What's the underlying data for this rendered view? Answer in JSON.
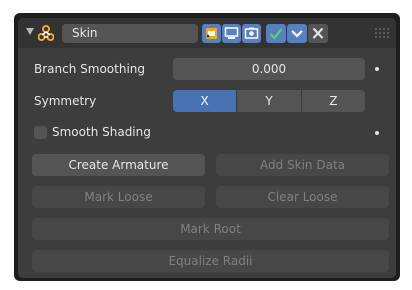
{
  "modifier": {
    "name": "Skin",
    "icons": {
      "collapse": "disclosure-triangle-icon",
      "modifier": "skin-modifier-icon",
      "edit_mode": "edit-mode-icon",
      "realtime": "viewport-display-icon",
      "render": "render-camera-icon",
      "apply": "checkmark-icon",
      "dropdown": "chevron-down-icon",
      "delete": "close-icon",
      "drag": "drag-grip-icon"
    },
    "colors": {
      "active_blue": "#5680c2",
      "modifier_icon_orange": "#f5a623",
      "apply_green": "#5fd35f"
    }
  },
  "props": {
    "branch_smoothing_label": "Branch Smoothing",
    "branch_smoothing_value": "0.000",
    "symmetry_label": "Symmetry",
    "symmetry_options": [
      "X",
      "Y",
      "Z"
    ],
    "symmetry_active": "X",
    "smooth_shading_label": "Smooth Shading",
    "smooth_shading_checked": false
  },
  "buttons": {
    "create_armature": "Create Armature",
    "add_skin_data": "Add Skin Data",
    "mark_loose": "Mark Loose",
    "clear_loose": "Clear Loose",
    "mark_root": "Mark Root",
    "equalize_radii": "Equalize Radii"
  }
}
